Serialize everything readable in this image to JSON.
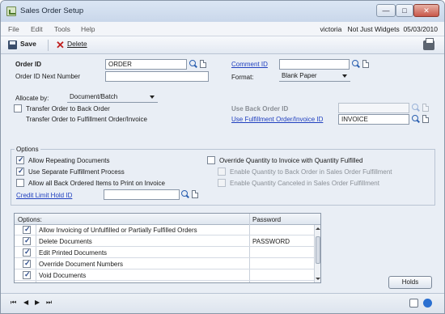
{
  "window": {
    "title": "Sales Order Setup",
    "minimize": "—",
    "maximize": "□",
    "close": "✕"
  },
  "menu": {
    "items": [
      "File",
      "Edit",
      "Tools",
      "Help"
    ],
    "user": "victoria",
    "company": "Not Just Widgets",
    "date": "05/03/2010"
  },
  "toolbar": {
    "save_label": "Save",
    "delete_label": "Delete"
  },
  "form": {
    "order_id_label": "Order ID",
    "order_id_value": "ORDER",
    "order_id_next_label": "Order ID Next Number",
    "order_id_next_value": "",
    "comment_id_label": "Comment ID",
    "comment_id_value": "",
    "format_label": "Format:",
    "format_value": "Blank Paper",
    "allocate_label": "Allocate by:",
    "allocate_value": "Document/Batch",
    "transfer_back_label": "Transfer Order to Back Order",
    "transfer_fulfill_label": "Transfer Order to Fulfillment Order/Invoice",
    "use_back_order_label": "Use Back Order ID",
    "use_fulfill_label": "Use Fulfillment Order/Invoice ID",
    "use_fulfill_value": "INVOICE"
  },
  "options": {
    "group_label": "Options",
    "allow_repeating": "Allow Repeating Documents",
    "use_separate": "Use Separate Fulfillment Process",
    "allow_all_back": "Allow all Back Ordered Items to Print on Invoice",
    "credit_limit_label": "Credit Limit Hold ID",
    "credit_limit_value": "",
    "override_qty": "Override Quantity to Invoice with Quantity Fulfilled",
    "enable_back": "Enable Quantity to Back Order in Sales Order Fulfillment",
    "enable_canceled": "Enable Quantity Canceled in Sales Order Fulfillment"
  },
  "grid": {
    "col_options": "Options:",
    "col_password": "Password",
    "rows": [
      {
        "label": "Allow Invoicing of Unfulfilled or Partially Fulfilled Orders",
        "password": "",
        "checked": true
      },
      {
        "label": "Delete Documents",
        "password": "PASSWORD",
        "checked": true
      },
      {
        "label": "Edit Printed Documents",
        "password": "",
        "checked": true
      },
      {
        "label": "Override Document Numbers",
        "password": "",
        "checked": true
      },
      {
        "label": "Void Documents",
        "password": "",
        "checked": true
      }
    ]
  },
  "footer": {
    "holds_label": "Holds"
  },
  "nav": {
    "first": "⏮",
    "prev": "◀",
    "next": "▶",
    "last": "⏭"
  },
  "colors": {
    "link": "#1f3fbf",
    "close_button": "#c8574a",
    "check": "#2b4a8a"
  }
}
